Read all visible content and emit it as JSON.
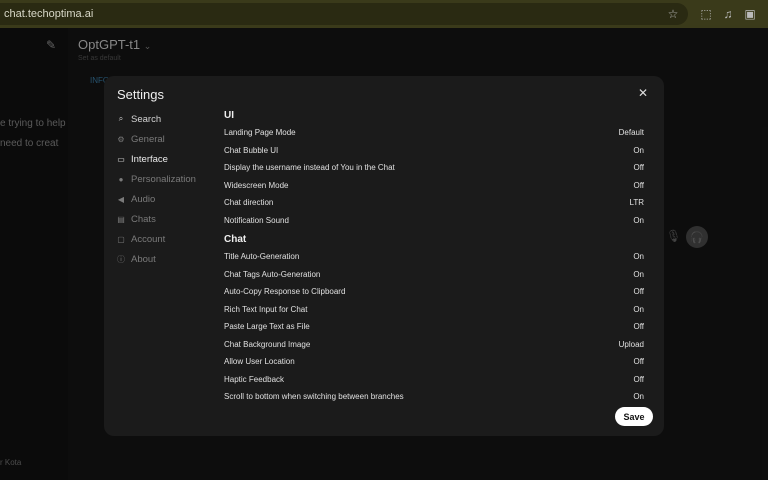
{
  "browser": {
    "url": "chat.techoptima.ai"
  },
  "app": {
    "model_name": "OptGPT-t1",
    "model_sub": "Set as default",
    "info_tag": "INFO",
    "side_lines": [
      "e trying to help",
      "need to creat"
    ],
    "user_name": "r Kota"
  },
  "settings": {
    "title": "Settings",
    "nav": [
      {
        "label": "Search",
        "icon": "search-icon"
      },
      {
        "label": "General",
        "icon": "gear-icon"
      },
      {
        "label": "Interface",
        "icon": "monitor-icon"
      },
      {
        "label": "Personalization",
        "icon": "user-icon"
      },
      {
        "label": "Audio",
        "icon": "speaker-icon"
      },
      {
        "label": "Chats",
        "icon": "chat-icon"
      },
      {
        "label": "Account",
        "icon": "account-icon"
      },
      {
        "label": "About",
        "icon": "info-icon"
      }
    ],
    "active_nav": "Interface",
    "ui_section": "UI",
    "ui_rows": [
      {
        "label": "Landing Page Mode",
        "value": "Default"
      },
      {
        "label": "Chat Bubble UI",
        "value": "On"
      },
      {
        "label": "Display the username instead of You in the Chat",
        "value": "Off"
      },
      {
        "label": "Widescreen Mode",
        "value": "Off"
      },
      {
        "label": "Chat direction",
        "value": "LTR"
      },
      {
        "label": "Notification Sound",
        "value": "On"
      }
    ],
    "chat_section": "Chat",
    "chat_rows": [
      {
        "label": "Title Auto-Generation",
        "value": "On"
      },
      {
        "label": "Chat Tags Auto-Generation",
        "value": "On"
      },
      {
        "label": "Auto-Copy Response to Clipboard",
        "value": "Off"
      },
      {
        "label": "Rich Text Input for Chat",
        "value": "On"
      },
      {
        "label": "Paste Large Text as File",
        "value": "Off"
      },
      {
        "label": "Chat Background Image",
        "value": "Upload"
      },
      {
        "label": "Allow User Location",
        "value": "Off"
      },
      {
        "label": "Haptic Feedback",
        "value": "Off"
      },
      {
        "label": "Scroll to bottom when switching between branches",
        "value": "On"
      }
    ],
    "save_label": "Save"
  }
}
